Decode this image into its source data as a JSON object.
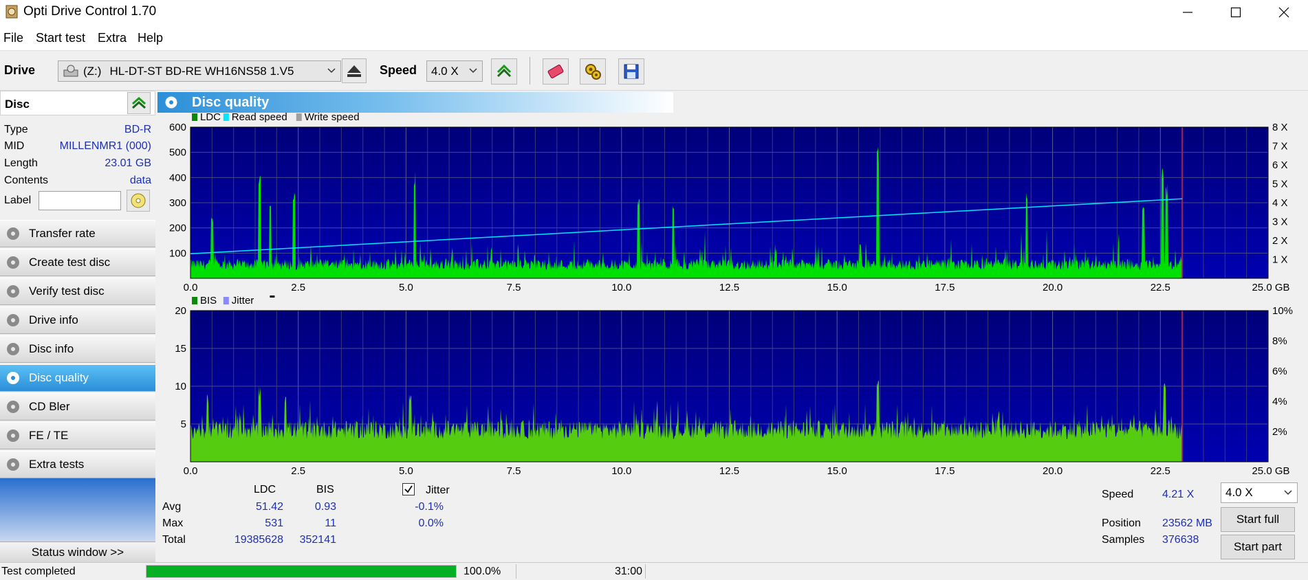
{
  "window": {
    "title": "Opti Drive Control 1.70"
  },
  "menu": {
    "file": "File",
    "start_test": "Start test",
    "extra": "Extra",
    "help": "Help"
  },
  "toolbar": {
    "drive_label": "Drive",
    "drive_letter": "(Z:)",
    "drive_name": "HL-DT-ST BD-RE  WH16NS58 1.V5",
    "speed_label": "Speed",
    "speed_value": "4.0 X"
  },
  "disc": {
    "header": "Disc",
    "type_label": "Type",
    "type_value": "BD-R",
    "mid_label": "MID",
    "mid_value": "MILLENMR1 (000)",
    "length_label": "Length",
    "length_value": "23.01 GB",
    "contents_label": "Contents",
    "contents_value": "data",
    "label_label": "Label",
    "label_value": ""
  },
  "nav": [
    {
      "label": "Transfer rate"
    },
    {
      "label": "Create test disc"
    },
    {
      "label": "Verify test disc"
    },
    {
      "label": "Drive info"
    },
    {
      "label": "Disc info"
    },
    {
      "label": "Disc quality",
      "active": true
    },
    {
      "label": "CD Bler"
    },
    {
      "label": "FE / TE"
    },
    {
      "label": "Extra tests"
    }
  ],
  "status_window_btn": "Status window >>",
  "panel": {
    "title": "Disc quality"
  },
  "colors": {
    "ldc": "#00e000",
    "bis": "#00e000",
    "read_speed": "#00e8ff",
    "write_speed": "#a0a0a0",
    "jitter": "#8888ff",
    "plot_bg_top": "#00007a",
    "plot_bg_bottom": "#0000b0",
    "accent": "#2a8fd8"
  },
  "chart_data": [
    {
      "type": "area",
      "legend": [
        "LDC",
        "Read speed",
        "Write speed"
      ],
      "x_ticks": [
        "0.0",
        "2.5",
        "5.0",
        "7.5",
        "10.0",
        "12.5",
        "15.0",
        "17.5",
        "20.0",
        "22.5",
        "25.0 GB"
      ],
      "y_ticks_left": [
        "600",
        "500",
        "400",
        "300",
        "200",
        "100"
      ],
      "y_ticks_right": [
        "8 X",
        "7 X",
        "6 X",
        "5 X",
        "4 X",
        "3 X",
        "2 X",
        "1 X"
      ],
      "xlim": [
        0,
        25
      ],
      "ylim": [
        0,
        600
      ],
      "y2lim": [
        0,
        8
      ],
      "data_end_gb": 23.01,
      "ldc_baseline": 55,
      "ldc_spikes": [
        [
          0.5,
          250
        ],
        [
          1.6,
          420
        ],
        [
          1.85,
          330
        ],
        [
          2.4,
          350
        ],
        [
          5.2,
          430
        ],
        [
          10.4,
          320
        ],
        [
          11.2,
          320
        ],
        [
          15.95,
          530
        ],
        [
          19.4,
          350
        ],
        [
          22.1,
          310
        ],
        [
          22.55,
          450
        ],
        [
          22.65,
          380
        ]
      ],
      "read_speed": {
        "name": "Read speed",
        "x": [
          0,
          23.01
        ],
        "y": [
          1.3,
          4.21
        ]
      }
    },
    {
      "type": "area",
      "legend": [
        "BIS",
        "Jitter"
      ],
      "x_ticks": [
        "0.0",
        "2.5",
        "5.0",
        "7.5",
        "10.0",
        "12.5",
        "15.0",
        "17.5",
        "20.0",
        "22.5",
        "25.0 GB"
      ],
      "y_ticks_left": [
        "20",
        "15",
        "10",
        "5"
      ],
      "y_ticks_right": [
        "10%",
        "8%",
        "6%",
        "4%",
        "2%"
      ],
      "xlim": [
        0,
        25
      ],
      "ylim": [
        0,
        20
      ],
      "y2lim": [
        0,
        10
      ],
      "data_end_gb": 23.01,
      "bis_baseline": 5,
      "bis_spikes": [
        [
          0.4,
          9
        ],
        [
          1.6,
          10
        ],
        [
          2.2,
          9
        ],
        [
          5.1,
          9
        ],
        [
          15.95,
          11
        ],
        [
          22.6,
          11
        ]
      ]
    }
  ],
  "stats": {
    "col_ldc": "LDC",
    "col_bis": "BIS",
    "col_jitter": "Jitter",
    "avg_label": "Avg",
    "avg_ldc": "51.42",
    "avg_bis": "0.93",
    "avg_jitter": "-0.1%",
    "max_label": "Max",
    "max_ldc": "531",
    "max_bis": "11",
    "max_jitter": "0.0%",
    "total_label": "Total",
    "total_ldc": "19385628",
    "total_bis": "352141",
    "jitter_checked": true
  },
  "side": {
    "speed_label": "Speed",
    "speed_value": "4.21 X",
    "speed_combo": "4.0 X",
    "start_full": "Start full",
    "position_label": "Position",
    "position_value": "23562 MB",
    "samples_label": "Samples",
    "samples_value": "376638",
    "start_part": "Start part"
  },
  "status": {
    "text": "Test completed",
    "progress_pct": "100.0%",
    "progress": 1.0,
    "time": "31:00"
  }
}
